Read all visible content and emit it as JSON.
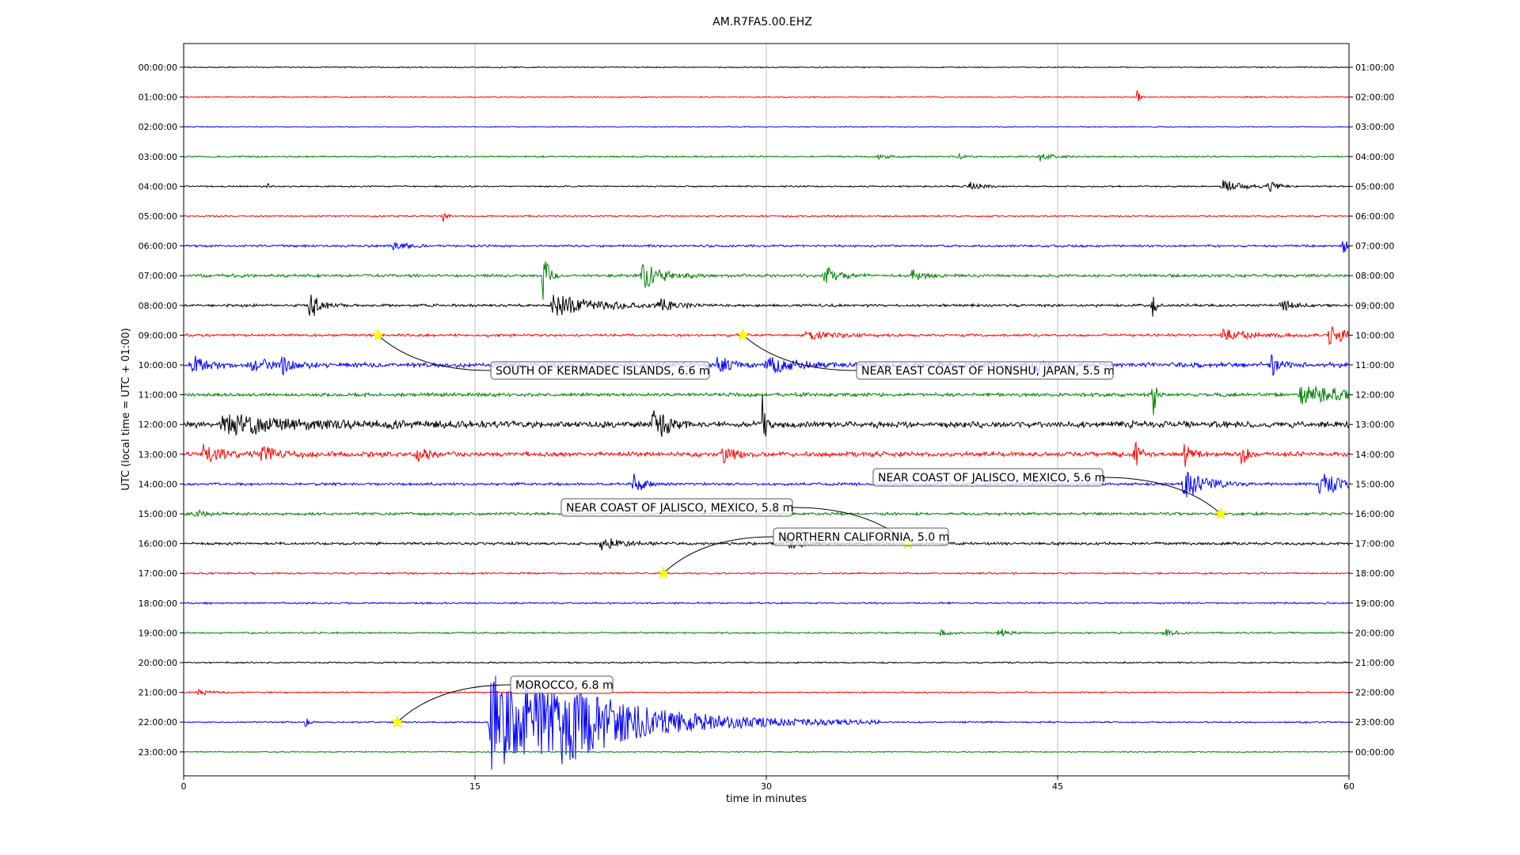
{
  "chart_data": {
    "type": "line",
    "title": "AM.R7FA5.00.EHZ",
    "xlabel": "time in minutes",
    "ylabel": "UTC (local time = UTC + 01:00)",
    "xlim": [
      0,
      60
    ],
    "xticks": [
      "0",
      "15",
      "30",
      "45",
      "60"
    ],
    "grid_x": true,
    "trace_colors": [
      "#000000",
      "#ff0000",
      "#0000ff",
      "#008000"
    ],
    "rows_left": [
      "00:00:00",
      "01:00:00",
      "02:00:00",
      "03:00:00",
      "04:00:00",
      "05:00:00",
      "06:00:00",
      "07:00:00",
      "08:00:00",
      "09:00:00",
      "10:00:00",
      "11:00:00",
      "12:00:00",
      "13:00:00",
      "14:00:00",
      "15:00:00",
      "16:00:00",
      "17:00:00",
      "18:00:00",
      "19:00:00",
      "20:00:00",
      "21:00:00",
      "22:00:00",
      "23:00:00"
    ],
    "rows_right": [
      "01:00:00",
      "02:00:00",
      "03:00:00",
      "04:00:00",
      "05:00:00",
      "06:00:00",
      "07:00:00",
      "08:00:00",
      "09:00:00",
      "10:00:00",
      "11:00:00",
      "12:00:00",
      "13:00:00",
      "14:00:00",
      "15:00:00",
      "16:00:00",
      "17:00:00",
      "18:00:00",
      "19:00:00",
      "20:00:00",
      "21:00:00",
      "22:00:00",
      "23:00:00",
      "00:00:00"
    ],
    "noise_levels": [
      0.6,
      0.7,
      0.5,
      0.8,
      0.8,
      0.8,
      1.2,
      1.5,
      1.4,
      1.3,
      2.4,
      1.8,
      3.2,
      2.4,
      1.4,
      1.4,
      1.4,
      0.9,
      0.9,
      0.9,
      0.8,
      0.7,
      0.8,
      0.6
    ],
    "bursts": [
      {
        "row": 1,
        "t": 49.1,
        "amp": 9,
        "dur": 0.2
      },
      {
        "row": 3,
        "t": 35.8,
        "amp": 3,
        "dur": 0.8
      },
      {
        "row": 3,
        "t": 39.9,
        "amp": 4,
        "dur": 0.5
      },
      {
        "row": 3,
        "t": 44.0,
        "amp": 6,
        "dur": 1.0
      },
      {
        "row": 4,
        "t": 4.3,
        "amp": 5,
        "dur": 0.2
      },
      {
        "row": 4,
        "t": 40.5,
        "amp": 6,
        "dur": 0.8
      },
      {
        "row": 4,
        "t": 53.5,
        "amp": 8,
        "dur": 1.5
      },
      {
        "row": 4,
        "t": 55.8,
        "amp": 8,
        "dur": 0.6
      },
      {
        "row": 5,
        "t": 13.4,
        "amp": 9,
        "dur": 0.2
      },
      {
        "row": 6,
        "t": 10.8,
        "amp": 6,
        "dur": 0.8
      },
      {
        "row": 6,
        "t": 59.7,
        "amp": 9,
        "dur": 0.4
      },
      {
        "row": 7,
        "t": 18.5,
        "amp": 30,
        "dur": 0.4
      },
      {
        "row": 7,
        "t": 23.6,
        "amp": 18,
        "dur": 1.3
      },
      {
        "row": 7,
        "t": 33.0,
        "amp": 12,
        "dur": 0.9
      },
      {
        "row": 7,
        "t": 37.5,
        "amp": 7,
        "dur": 0.8
      },
      {
        "row": 8,
        "t": 6.5,
        "amp": 18,
        "dur": 0.8
      },
      {
        "row": 8,
        "t": 19.0,
        "amp": 14,
        "dur": 3.0
      },
      {
        "row": 8,
        "t": 24.5,
        "amp": 9,
        "dur": 1.0
      },
      {
        "row": 8,
        "t": 49.9,
        "amp": 16,
        "dur": 0.2
      },
      {
        "row": 8,
        "t": 56.5,
        "amp": 8,
        "dur": 0.7
      },
      {
        "row": 9,
        "t": 32.0,
        "amp": 6,
        "dur": 2.0
      },
      {
        "row": 9,
        "t": 53.5,
        "amp": 7,
        "dur": 2.0
      },
      {
        "row": 9,
        "t": 59.0,
        "amp": 16,
        "dur": 1.0
      },
      {
        "row": 10,
        "t": 0.5,
        "amp": 12,
        "dur": 1.0
      },
      {
        "row": 10,
        "t": 3.5,
        "amp": 10,
        "dur": 1.2
      },
      {
        "row": 10,
        "t": 5.0,
        "amp": 10,
        "dur": 1.0
      },
      {
        "row": 10,
        "t": 27.5,
        "amp": 10,
        "dur": 1.0
      },
      {
        "row": 10,
        "t": 30.0,
        "amp": 12,
        "dur": 2.0
      },
      {
        "row": 10,
        "t": 43.8,
        "amp": 14,
        "dur": 0.5
      },
      {
        "row": 10,
        "t": 56.0,
        "amp": 12,
        "dur": 0.6
      },
      {
        "row": 11,
        "t": 49.9,
        "amp": 34,
        "dur": 0.2
      },
      {
        "row": 11,
        "t": 57.5,
        "amp": 12,
        "dur": 4.0
      },
      {
        "row": 12,
        "t": 2.0,
        "amp": 12,
        "dur": 6.0
      },
      {
        "row": 12,
        "t": 24.2,
        "amp": 22,
        "dur": 1.0
      },
      {
        "row": 12,
        "t": 29.8,
        "amp": 36,
        "dur": 0.2
      },
      {
        "row": 13,
        "t": 1.0,
        "amp": 10,
        "dur": 1.5
      },
      {
        "row": 13,
        "t": 4.0,
        "amp": 10,
        "dur": 1.5
      },
      {
        "row": 13,
        "t": 12.0,
        "amp": 8,
        "dur": 1.0
      },
      {
        "row": 13,
        "t": 27.8,
        "amp": 18,
        "dur": 0.6
      },
      {
        "row": 13,
        "t": 49.0,
        "amp": 18,
        "dur": 0.3
      },
      {
        "row": 13,
        "t": 51.5,
        "amp": 18,
        "dur": 0.5
      },
      {
        "row": 13,
        "t": 54.5,
        "amp": 18,
        "dur": 0.3
      },
      {
        "row": 14,
        "t": 23.2,
        "amp": 22,
        "dur": 0.5
      },
      {
        "row": 14,
        "t": 51.5,
        "amp": 20,
        "dur": 1.5
      },
      {
        "row": 14,
        "t": 58.5,
        "amp": 16,
        "dur": 1.5
      },
      {
        "row": 15,
        "t": 0.5,
        "amp": 6,
        "dur": 0.8
      },
      {
        "row": 16,
        "t": 21.5,
        "amp": 8,
        "dur": 1.5
      },
      {
        "row": 16,
        "t": 31.0,
        "amp": 12,
        "dur": 0.8
      },
      {
        "row": 19,
        "t": 39.0,
        "amp": 5,
        "dur": 0.6
      },
      {
        "row": 19,
        "t": 42.0,
        "amp": 7,
        "dur": 0.5
      },
      {
        "row": 19,
        "t": 50.5,
        "amp": 6,
        "dur": 0.6
      },
      {
        "row": 21,
        "t": 0.7,
        "amp": 5,
        "dur": 0.8
      },
      {
        "row": 22,
        "t": 6.3,
        "amp": 6,
        "dur": 0.2
      },
      {
        "row": 22,
        "t": 15.8,
        "amp": 66,
        "dur": 8.0
      },
      {
        "row": 22,
        "t": 19.5,
        "amp": 24,
        "dur": 3.0
      }
    ],
    "events": [
      {
        "label": "SOUTH OF KERMADEC ISLANDS, 6.6 m",
        "row": 9,
        "t": 10.0
      },
      {
        "label": "NEAR EAST COAST OF HONSHU, JAPAN, 5.5 m",
        "row": 9,
        "t": 28.8
      },
      {
        "label": "NEAR COAST OF JALISCO, MEXICO, 5.6 m",
        "row": 15,
        "t": 53.4
      },
      {
        "label": "NEAR COAST OF JALISCO, MEXICO, 5.8 m",
        "row": 16,
        "t": 37.3
      },
      {
        "label": "NORTHERN CALIFORNIA, 5.0 m",
        "row": 17,
        "t": 24.7
      },
      {
        "label": "MOROCCO, 6.8 m",
        "row": 22,
        "t": 11.0
      }
    ]
  }
}
